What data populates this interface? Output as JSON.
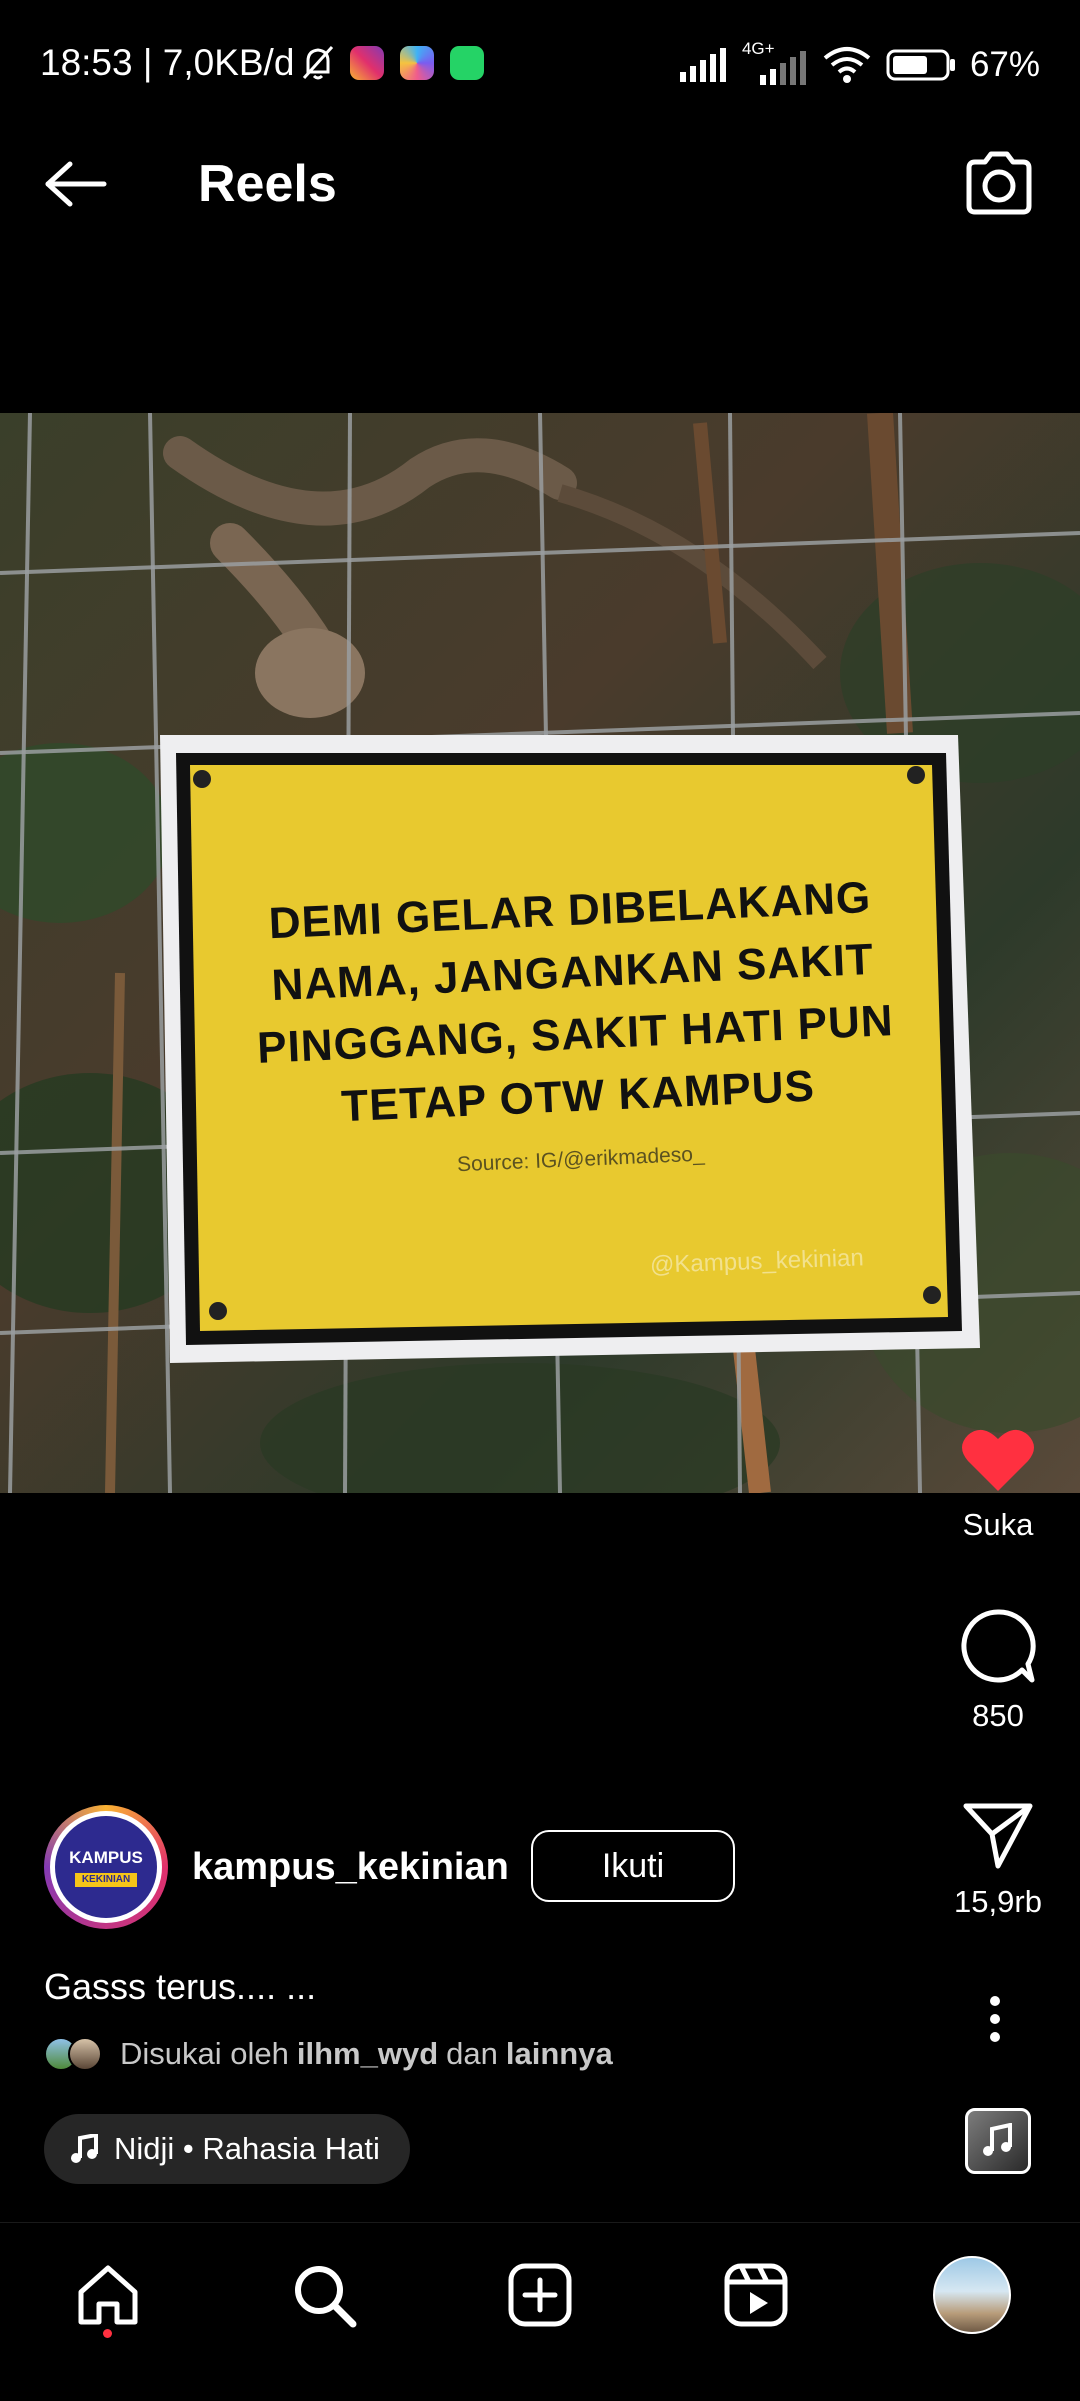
{
  "status_bar": {
    "time_speed": "18:53 | 7,0KB/d",
    "network": "4G+",
    "battery": "67%",
    "icons": [
      "mute-bell-icon",
      "instagram-app-icon",
      "pinwheel-app-icon",
      "whatsapp-app-icon",
      "signal-icon",
      "wifi-icon",
      "battery-icon"
    ]
  },
  "header": {
    "title": "Reels"
  },
  "media": {
    "sign_lines": [
      "DEMI GELAR DIBELAKANG",
      "NAMA, JANGANKAN SAKIT",
      "PINGGANG, SAKIT HATI PUN",
      "TETAP OTW KAMPUS"
    ],
    "sign_source": "Source: IG/@erikmadeso_",
    "watermark": "@Kampus_kekinian",
    "sign_color": "#e8c92f"
  },
  "actions": {
    "like_label": "Suka",
    "comment_count": "850",
    "share_count": "15,9rb",
    "like_color": "#ff3040"
  },
  "author": {
    "username": "kampus_kekinian",
    "follow_label": "Ikuti",
    "avatar_text": "KAMPUS",
    "avatar_sub": "KEKINIAN"
  },
  "caption": {
    "text": "Gasss terus.... ..."
  },
  "liked_by": {
    "prefix": "Disukai oleh ",
    "user": "ilhm_wyd",
    "middle": " dan ",
    "others": "lainnya"
  },
  "music": {
    "label": "Nidji • Rahasia Hati"
  },
  "nav": {
    "items": [
      "home-icon",
      "search-icon",
      "create-icon",
      "reels-icon",
      "profile-avatar"
    ]
  }
}
